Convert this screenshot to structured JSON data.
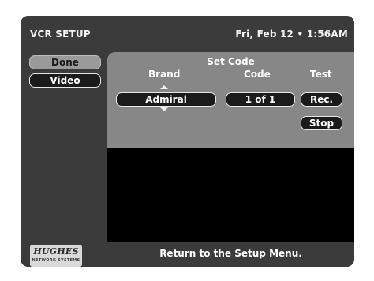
{
  "header": {
    "title": "VCR SETUP",
    "datetime": "Fri, Feb 12 • 1:56AM"
  },
  "left_menu": {
    "done_label": "Done",
    "video_label": "Video"
  },
  "panel": {
    "title": "Set Code",
    "columns": {
      "brand": "Brand",
      "code": "Code",
      "test": "Test"
    },
    "brand_value": "Admiral",
    "code_value": "1 of 1",
    "rec_label": "Rec.",
    "stop_label": "Stop"
  },
  "footer": {
    "logo_text": "HUGHES",
    "logo_subtext": "NETWORK SYSTEMS",
    "message": "Return to the Setup Menu."
  },
  "colors": {
    "background": "#3b3b3b",
    "panel": "#878787",
    "button_fill": "#1b1b1b",
    "selected_button": "#9a9a9a"
  }
}
